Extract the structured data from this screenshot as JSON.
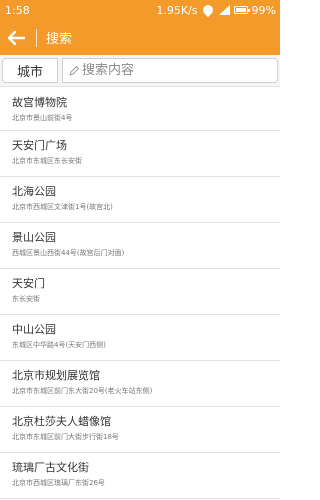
{
  "status_bar": {
    "time": "1:58",
    "speed": "1.95K/s",
    "battery": "99%"
  },
  "app_bar": {
    "title": "搜索"
  },
  "search": {
    "city_label": "城市",
    "placeholder": "搜索内容"
  },
  "results": [
    {
      "name": "故宫博物院",
      "address": "北京市景山前街4号"
    },
    {
      "name": "天安门广场",
      "address": "北京市东城区东长安街"
    },
    {
      "name": "北海公园",
      "address": "北京市西城区文津街1号(故宫北)"
    },
    {
      "name": "景山公园",
      "address": "西城区景山西街44号(故宫后门对面)"
    },
    {
      "name": "天安门",
      "address": "东长安街"
    },
    {
      "name": "中山公园",
      "address": "东城区中华路4号(天安门西侧)"
    },
    {
      "name": "北京市规划展览馆",
      "address": "北京市东城区前门东大街20号(老火车站东侧)"
    },
    {
      "name": "北京杜莎夫人蜡像馆",
      "address": "北京市东城区前门大街步行街18号"
    },
    {
      "name": "琉璃厂古文化街",
      "address": "北京市西城区琉璃厂东街26号"
    }
  ],
  "colors": {
    "accent": "#f39a2b"
  }
}
